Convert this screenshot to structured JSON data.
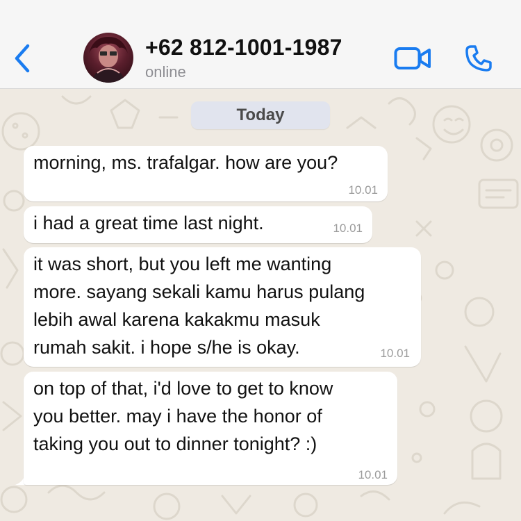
{
  "header": {
    "contact_name": "+62 812-1001-1987",
    "status": "online",
    "icons": [
      "chevron-left-icon",
      "avatar",
      "video-camera-icon",
      "phone-icon"
    ],
    "accent_color": "#1a7cf0"
  },
  "chat": {
    "date_label": "Today",
    "messages": [
      {
        "text": "morning, ms. trafalgar. how are you?",
        "time": "10.01"
      },
      {
        "text": "i had a great time last night.",
        "time": "10.01"
      },
      {
        "text": "it was short, but you left me wanting\nmore. sayang sekali kamu harus pulang\nlebih awal karena kakakmu masuk\nrumah sakit. i hope s/he is okay.",
        "time": "10.01"
      },
      {
        "text": "on top of that, i'd love to get to know\nyou better. may i have the honor of\ntaking you out to dinner tonight? :)",
        "time": "10.01"
      }
    ]
  }
}
